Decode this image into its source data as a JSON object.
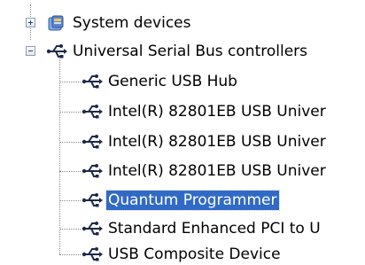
{
  "tree": {
    "nodes": [
      {
        "label": "System devices",
        "icon": "system-devices-icon",
        "expander": "plus",
        "level": 0,
        "selected": false
      },
      {
        "label": "Universal Serial Bus controllers",
        "icon": "usb-icon",
        "expander": "minus",
        "level": 0,
        "selected": false
      },
      {
        "label": "Generic USB Hub",
        "icon": "usb-icon",
        "level": 1,
        "selected": false
      },
      {
        "label": "Intel(R) 82801EB USB Univer",
        "icon": "usb-icon",
        "level": 1,
        "selected": false
      },
      {
        "label": "Intel(R) 82801EB USB Univer",
        "icon": "usb-icon",
        "level": 1,
        "selected": false
      },
      {
        "label": "Intel(R) 82801EB USB Univer",
        "icon": "usb-icon",
        "level": 1,
        "selected": false
      },
      {
        "label": "Quantum Programmer",
        "icon": "usb-icon",
        "level": 1,
        "selected": true
      },
      {
        "label": "Standard Enhanced PCI to U",
        "icon": "usb-icon",
        "level": 1,
        "selected": false
      },
      {
        "label": "USB Composite Device",
        "icon": "usb-icon",
        "level": 1,
        "selected": false
      }
    ]
  },
  "colors": {
    "selection_bg": "#316ac5",
    "selection_text": "#ffffff",
    "tree_line": "#8a8a8a",
    "usb_icon": "#1e2a4a"
  }
}
